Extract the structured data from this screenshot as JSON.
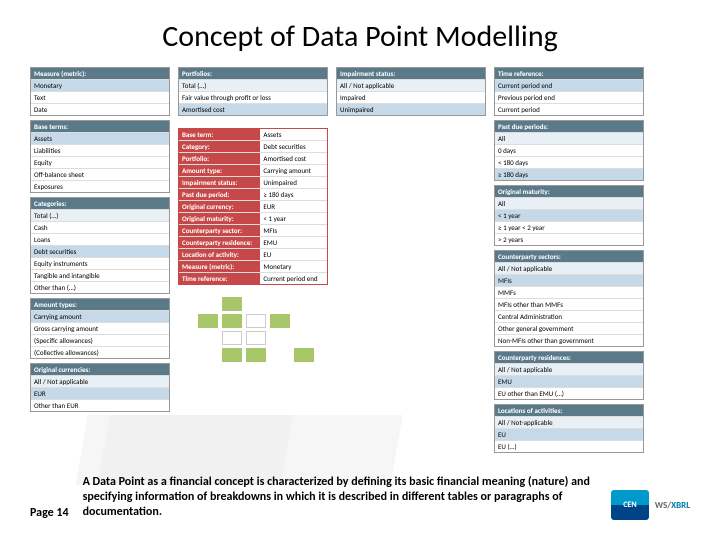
{
  "title": "Concept of Data Point Modelling",
  "page_label": "Page 14",
  "description": "A Data Point as a financial concept is characterized by defining its basic financial meaning  (nature) and specifying information of breakdowns in which  it is described  in different tables or paragraphs of documentation.",
  "col1": {
    "measure": {
      "hdr": "Measure (metric):",
      "rows": [
        "Monetary",
        "Text",
        "Date"
      ]
    },
    "base": {
      "hdr": "Base terms:",
      "rows": [
        "Assets",
        "Liabilities",
        "Equity",
        "Off-balance sheet",
        "Exposures"
      ]
    },
    "categories": {
      "hdr": "Categories:",
      "rows": [
        "Total (…)",
        "Cash",
        "Loans",
        "Debt securities",
        "Equity instruments",
        "Tangible and intangible",
        "Other than (…)"
      ]
    },
    "amount": {
      "hdr": "Amount types:",
      "rows": [
        "Carrying amount",
        "Gross carrying amount",
        "(Specific allowances)",
        "(Collective allowances)"
      ]
    },
    "orig": {
      "hdr": "Original currencies:",
      "rows": [
        "All / Not applicable",
        "EUR",
        "Other than EUR"
      ]
    }
  },
  "col2": {
    "portfolios": {
      "hdr": "Portfolios:",
      "rows": [
        "Total (…)",
        "Fair value through profit or loss",
        "Amortised cost"
      ]
    }
  },
  "center": [
    {
      "label": "Base term:",
      "val": "Assets"
    },
    {
      "label": "Category:",
      "val": "Debt securities"
    },
    {
      "label": "Portfolio:",
      "val": "Amortised cost"
    },
    {
      "label": "Amount type:",
      "val": "Carrying amount"
    },
    {
      "label": "Impairment status:",
      "val": "Unimpaired"
    },
    {
      "label": "Past due period:",
      "val": "≥ 180 days"
    },
    {
      "label": "Original currency:",
      "val": "EUR"
    },
    {
      "label": "Original maturity:",
      "val": "< 1 year"
    },
    {
      "label": "Counterparty sector:",
      "val": "MFIs"
    },
    {
      "label": "Counterparty residence:",
      "val": "EMU"
    },
    {
      "label": "Location of activity:",
      "val": "EU"
    },
    {
      "label": "Measure (metric):",
      "val": "Monetary"
    },
    {
      "label": "Time reference:",
      "val": "Current period end"
    }
  ],
  "col3": {
    "impair": {
      "hdr": "Impairment status:",
      "rows": [
        "All / Not applicable",
        "Impaired",
        "Unimpaired"
      ]
    }
  },
  "col4": {
    "timeref": {
      "hdr": "Time reference:",
      "rows": [
        "Current period end",
        "Previous period end",
        "Current period"
      ]
    },
    "pastdue": {
      "hdr": "Past due periods:",
      "rows": [
        "All",
        "0 days",
        "< 180 days",
        "≥ 180 days"
      ]
    },
    "origmat": {
      "hdr": "Original maturity:",
      "rows": [
        "All",
        "< 1 year",
        "≥ 1 year < 2 year",
        "> 2 years"
      ]
    },
    "cpsector": {
      "hdr": "Counterparty sectors:",
      "rows": [
        "All / Not applicable",
        "MFIs",
        "MMFs",
        "MFIs other than MMFs",
        "Central Administration",
        "Other general government",
        "Non-MFIs other than government"
      ]
    },
    "cpres": {
      "hdr": "Counterparty residences:",
      "rows": [
        "All / Not applicable",
        "EMU",
        "EU other than EMU (…)"
      ]
    },
    "locact": {
      "hdr": "Locations of activities:",
      "rows": [
        "All / Not-applicable",
        "EU",
        "EU (…)"
      ]
    }
  },
  "logo": {
    "ws": "WS/",
    "xbrl": "XBRL"
  }
}
